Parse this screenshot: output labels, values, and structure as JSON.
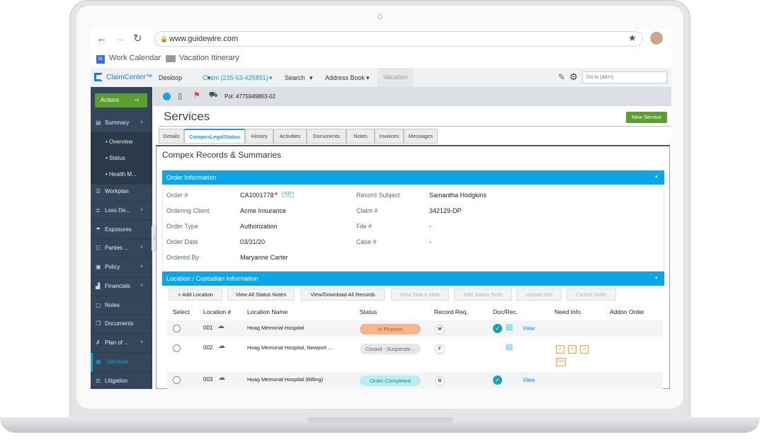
{
  "browser": {
    "url": "www.guidewire.com",
    "bookmarks": [
      {
        "label": "Work Calendar",
        "icon": "calendar-icon"
      },
      {
        "label": "Vacation Itinerary",
        "icon": "folder-icon"
      }
    ]
  },
  "app": {
    "brand": "ClaimCenter™",
    "nav": [
      "Desktop",
      "Claim (235-53-425891)",
      "Search",
      "Address Book",
      "Vacation"
    ],
    "goto_placeholder": "Go to (Alt+/)"
  },
  "infobar": {
    "policy": "Pol: 4775949863-02"
  },
  "sidebar": {
    "actions": "Actions",
    "items": [
      {
        "label": "Summary",
        "expanded": true
      },
      {
        "label": "Overview",
        "sub": true
      },
      {
        "label": "Status",
        "sub": true
      },
      {
        "label": "Health M...",
        "sub": true
      },
      {
        "label": "Workplan"
      },
      {
        "label": "Loss De..."
      },
      {
        "label": "Exposures"
      },
      {
        "label": "Parties ..."
      },
      {
        "label": "Policy"
      },
      {
        "label": "Financials"
      },
      {
        "label": "Notes"
      },
      {
        "label": "Documents"
      },
      {
        "label": "Plan of ..."
      },
      {
        "label": "Services",
        "active": true
      },
      {
        "label": "Litigation"
      }
    ]
  },
  "page": {
    "title": "Services",
    "new_service": "New Service",
    "tabs": [
      "Details",
      "CompexLegalStatus",
      "History",
      "Activities",
      "Documents",
      "Notes",
      "Invoices",
      "Messages"
    ],
    "active_tab": "CompexLegalStatus",
    "section_title": "Compex Records & Summaries"
  },
  "order": {
    "header": "Order Information",
    "badge": "A40",
    "left": [
      {
        "label": "Order #",
        "value": "CA1001778"
      },
      {
        "label": "Ordering Client",
        "value": "Acme Insurance"
      },
      {
        "label": "Order Type",
        "value": "Authorization"
      },
      {
        "label": "Order Date",
        "value": "03/31/20"
      },
      {
        "label": "Ordered By",
        "value": "Maryanne Carter"
      }
    ],
    "right": [
      {
        "label": "Record Subject",
        "value": "Samantha Hodgkins"
      },
      {
        "label": "Claim #",
        "value": "342129-DP"
      },
      {
        "label": "File #",
        "value": "-"
      },
      {
        "label": "Case #",
        "value": "-"
      }
    ]
  },
  "locations": {
    "header": "Location / Custodian Information",
    "buttons": [
      {
        "label": "+ Add Location",
        "enabled": true
      },
      {
        "label": "View All Status Notes",
        "enabled": true
      },
      {
        "label": "View/Download All Records",
        "enabled": true
      },
      {
        "label": "View Status Note",
        "enabled": false
      },
      {
        "label": "Add Status Note",
        "enabled": false
      },
      {
        "label": "Upload Doc",
        "enabled": false
      },
      {
        "label": "Cancel Order",
        "enabled": false
      }
    ],
    "columns": [
      "Select",
      "Location #",
      "Location Name",
      "Status",
      "Record Req.",
      "Doc/Rec.",
      "Need Info",
      "Addon Order"
    ],
    "rows": [
      {
        "num": "001",
        "name": "Hoag Memorial Hospital",
        "status": "In Process",
        "req": "M",
        "view": "View",
        "need": []
      },
      {
        "num": "002",
        "name": "Hoag Memorial Hospital, Newport ...",
        "status": "Closed - Suspende...",
        "req": "F",
        "view": "",
        "need": [
          "A",
          "A",
          "A",
          "PHI"
        ]
      },
      {
        "num": "003",
        "name": "Hoag Memorial Hospital (Billing)",
        "status": "Order Completed",
        "req": "B",
        "view": "View",
        "need": []
      }
    ]
  },
  "colors": {
    "accent": "#0aa6e8",
    "green": "#5a9e2f",
    "sidebar": "#34475a",
    "in_process": "#f8b48a",
    "completed": "#b8eef0",
    "closed": "#e4e7ec"
  }
}
